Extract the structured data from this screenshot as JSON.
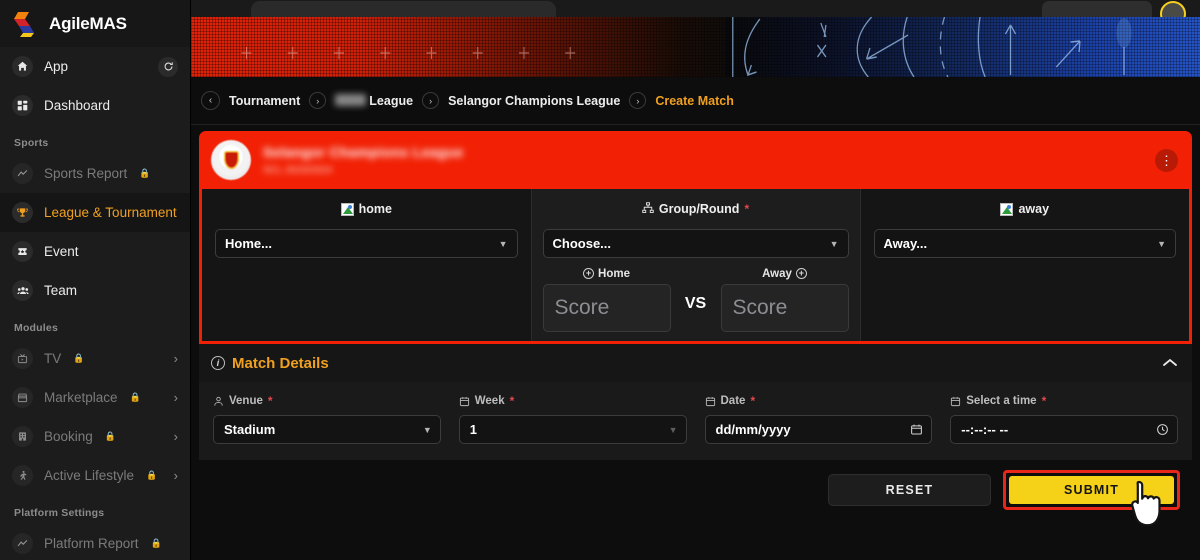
{
  "brand": {
    "name": "AgileMAS",
    "logo_icon": "agilemas-logo"
  },
  "sidebar": {
    "items": [
      {
        "label": "App",
        "icon": "home-icon",
        "trailing": "refresh-icon"
      },
      {
        "label": "Dashboard",
        "icon": "grid-icon"
      }
    ],
    "sections": [
      {
        "title": "Sports",
        "items": [
          {
            "label": "Sports Report",
            "icon": "trend-icon",
            "locked": true
          },
          {
            "label": "League & Tournament",
            "icon": "trophy-icon",
            "active": true
          },
          {
            "label": "Event",
            "icon": "ticket-icon"
          },
          {
            "label": "Team",
            "icon": "people-icon"
          }
        ]
      },
      {
        "title": "Modules",
        "items": [
          {
            "label": "TV",
            "icon": "tv-icon",
            "locked": true,
            "expandable": true
          },
          {
            "label": "Marketplace",
            "icon": "store-icon",
            "locked": true,
            "expandable": true
          },
          {
            "label": "Booking",
            "icon": "building-icon",
            "locked": true,
            "expandable": true
          },
          {
            "label": "Active Lifestyle",
            "icon": "runner-icon",
            "locked": true,
            "expandable": true
          }
        ]
      },
      {
        "title": "Platform Settings",
        "items": [
          {
            "label": "Platform Report",
            "icon": "trend-icon",
            "locked": true
          }
        ]
      }
    ]
  },
  "breadcrumb": {
    "back_icon": "chevron-left-icon",
    "separator": "›",
    "items": [
      {
        "label": "Tournament",
        "redacted": false
      },
      {
        "label": "League",
        "redacted": true
      },
      {
        "label": "Selangor Champions League",
        "redacted": false
      },
      {
        "label": "Create Match",
        "redacted": false,
        "current": true
      }
    ]
  },
  "league_header": {
    "title": "Selangor Champions League",
    "subtitle": "SCL 2023/2024",
    "crest_icon": "shield-crest-icon",
    "menu_icon": "more-vertical-icon",
    "accent_color": "#f22105"
  },
  "match_form": {
    "home": {
      "label": "home",
      "label_is_broken_image": true,
      "select_value": "Home...",
      "caret_icon": "chevron-down-icon"
    },
    "middle": {
      "label": "Group/Round",
      "label_icon": "sitemap-icon",
      "required": true,
      "required_mark": "*",
      "select_value": "Choose...",
      "caret_icon": "chevron-down-icon",
      "home_score_label": "Home",
      "away_score_label": "Away",
      "score_add_icon": "circle-plus-icon",
      "home_score_placeholder": "Score",
      "away_score_placeholder": "Score",
      "vs_text": "VS"
    },
    "away": {
      "label": "away",
      "label_is_broken_image": true,
      "select_value": "Away...",
      "caret_icon": "chevron-down-icon"
    }
  },
  "match_details": {
    "title": "Match Details",
    "info_icon": "info-circle-icon",
    "collapse_icon": "chevron-up-icon",
    "fields": [
      {
        "label": "Venue",
        "icon": "person-pin-icon",
        "required_mark": "*",
        "value": "Stadium",
        "end_icon": "chevron-down-icon"
      },
      {
        "label": "Week",
        "icon": "calendar-icon",
        "required_mark": "*",
        "value": "1",
        "end_icon": "chevron-down-icon"
      },
      {
        "label": "Date",
        "icon": "calendar-icon",
        "required_mark": "*",
        "value": "dd/mm/yyyy",
        "end_icon": "calendar-picker-icon"
      },
      {
        "label": "Select a time",
        "icon": "calendar-icon",
        "required_mark": "*",
        "value": "--:--:-- --",
        "end_icon": "clock-icon"
      }
    ]
  },
  "actions": {
    "reset_label": "RESET",
    "submit_label": "SUBMIT",
    "submit_highlight_color": "#e8261a",
    "submit_color": "#f5d118",
    "cursor_icon": "pointer-hand-cursor"
  }
}
